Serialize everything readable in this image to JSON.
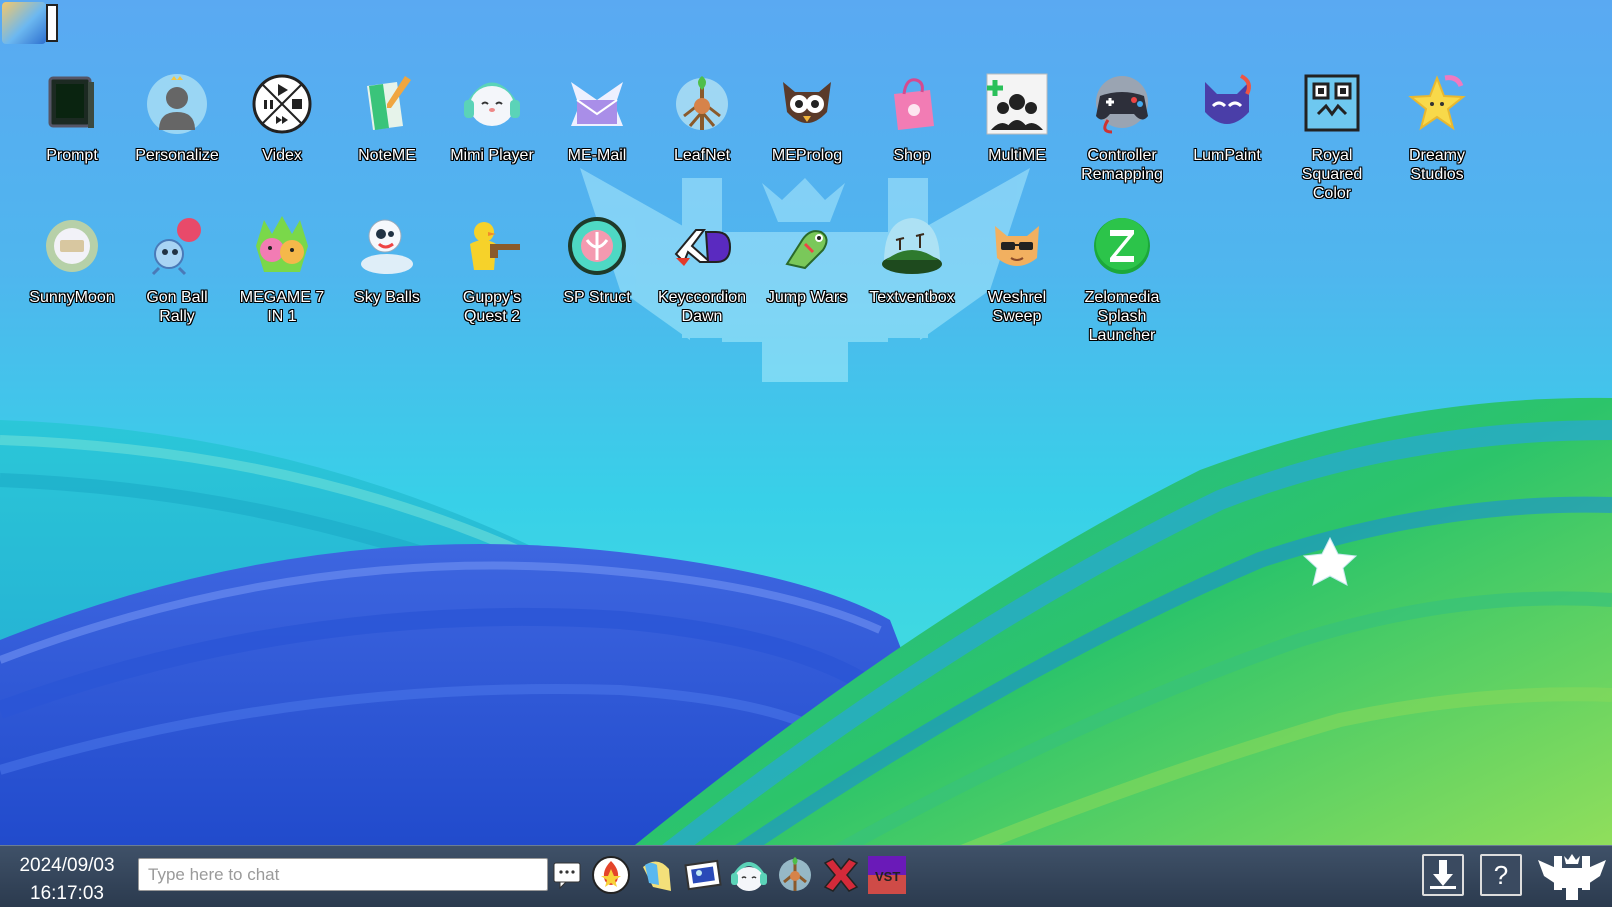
{
  "desktop": {
    "icons": [
      {
        "label": "Prompt",
        "icon": "terminal-icon"
      },
      {
        "label": "Personalize",
        "icon": "person-crown-icon"
      },
      {
        "label": "Videx",
        "icon": "video-controls-icon"
      },
      {
        "label": "NoteME",
        "icon": "notepad-icon"
      },
      {
        "label": "Mimi Player",
        "icon": "headphone-cat-icon"
      },
      {
        "label": "ME-Mail",
        "icon": "envelope-icon"
      },
      {
        "label": "LeafNet",
        "icon": "leaf-globe-icon"
      },
      {
        "label": "MEProlog",
        "icon": "owl-icon"
      },
      {
        "label": "Shop",
        "icon": "shopping-bag-icon"
      },
      {
        "label": "MultiME",
        "icon": "users-icon"
      },
      {
        "label": "Controller Remapping",
        "icon": "gamepad-icon"
      },
      {
        "label": "LumPaint",
        "icon": "cat-paint-icon"
      },
      {
        "label": "Royal Squared Color",
        "icon": "square-face-icon"
      },
      {
        "label": "Dreamy Studios",
        "icon": "star-icon"
      },
      {
        "label": "SunnyMoon",
        "icon": "sun-icon"
      },
      {
        "label": "Gon Ball Rally",
        "icon": "ball-creature-icon"
      },
      {
        "label": "MEGAME 7 IN 1",
        "icon": "monsters-icon"
      },
      {
        "label": "Sky Balls",
        "icon": "snowman-icon"
      },
      {
        "label": "Guppy's Quest 2",
        "icon": "duck-blaster-icon"
      },
      {
        "label": "SP Struct",
        "icon": "circle-emblem-icon"
      },
      {
        "label": "Keyccordion Dawn",
        "icon": "keyboard-logo-icon"
      },
      {
        "label": "Jump Wars",
        "icon": "frog-icon"
      },
      {
        "label": "Textventbox",
        "icon": "island-globe-icon"
      },
      {
        "label": "Weshrel Sweep",
        "icon": "cool-fox-icon"
      },
      {
        "label": "Zelomedia Splash Launcher",
        "icon": "letter-z-icon"
      }
    ]
  },
  "taskbar": {
    "date": "2024/09/03",
    "time": "16:17:03",
    "chat_placeholder": "Type here to chat",
    "pinned": [
      "chat-bubble-icon",
      "flame-badge-icon",
      "leaf-app-icon",
      "photo-app-icon",
      "mimi-app-icon",
      "leafnet-app-icon",
      "red-x-app-icon",
      "vst-app-icon"
    ],
    "right": [
      "download-icon",
      "help-icon",
      "crest-icon"
    ]
  },
  "colors": {
    "taskbar": "#2f3f54",
    "accent": "#33c8e6"
  }
}
